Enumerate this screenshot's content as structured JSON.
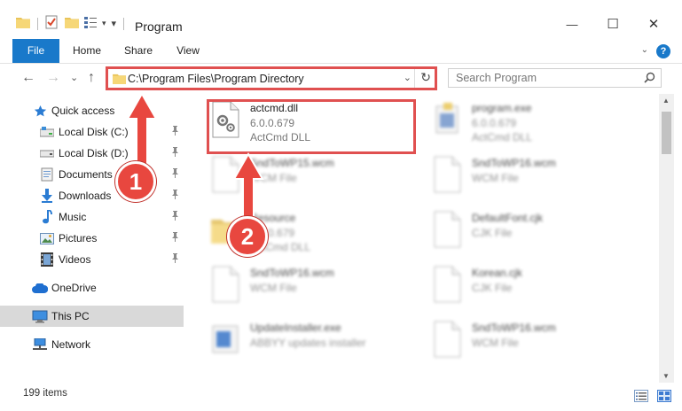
{
  "window": {
    "title": "Program",
    "minimize_glyph": "—",
    "maximize_glyph": "☐",
    "close_glyph": "✕"
  },
  "ribbon": {
    "tabs": [
      {
        "label": "File"
      },
      {
        "label": "Home"
      },
      {
        "label": "Share"
      },
      {
        "label": "View"
      }
    ],
    "help_glyph": "?",
    "collapse_glyph": "⌄"
  },
  "nav": {
    "back_glyph": "←",
    "forward_glyph": "→",
    "recent_glyph": "⌄",
    "up_glyph": "↑",
    "address": "C:\\Program Files\\Program Directory",
    "address_dropdown_glyph": "⌄",
    "refresh_glyph": "↻",
    "search_placeholder": "Search Program"
  },
  "sidebar": {
    "items": [
      {
        "label": "Quick access",
        "icon": "star-icon",
        "pinned": false
      },
      {
        "label": "Local Disk (C:)",
        "icon": "drive-icon",
        "pinned": true
      },
      {
        "label": "Local Disk (D:)",
        "icon": "drive-icon",
        "pinned": true
      },
      {
        "label": "Documents",
        "icon": "documents-icon",
        "pinned": true
      },
      {
        "label": "Downloads",
        "icon": "download-icon",
        "pinned": true
      },
      {
        "label": "Music",
        "icon": "music-icon",
        "pinned": true
      },
      {
        "label": "Pictures",
        "icon": "pictures-icon",
        "pinned": true
      },
      {
        "label": "Videos",
        "icon": "videos-icon",
        "pinned": true
      },
      {
        "label": "OneDrive",
        "icon": "cloud-icon",
        "pinned": false
      },
      {
        "label": "This PC",
        "icon": "computer-icon",
        "pinned": false,
        "selected": true
      },
      {
        "label": "Network",
        "icon": "network-icon",
        "pinned": false
      }
    ],
    "pin_glyph": "📌"
  },
  "files": [
    {
      "name": "actcmd.dll",
      "line2": "6.0.0.679",
      "line3": "ActCmd DLL",
      "icon": "dll-gear-icon",
      "highlighted": true
    },
    {
      "name": "program.exe",
      "line2": "6.0.0.679",
      "line3": "ActCmd DLL",
      "icon": "exe-icon"
    },
    {
      "name": "SndToWP15.wcm",
      "line2": "WCM File",
      "line3": "",
      "icon": "file-icon"
    },
    {
      "name": "SndToWP16.wcm",
      "line2": "WCM File",
      "line3": "",
      "icon": "file-icon"
    },
    {
      "name": "Resource",
      "line2": "6.0.0.679",
      "line3": "ActCmd DLL",
      "icon": "folder-icon"
    },
    {
      "name": "DefaultFont.cjk",
      "line2": "CJK File",
      "line3": "",
      "icon": "file-icon"
    },
    {
      "name": "SndToWP16.wcm",
      "line2": "WCM File",
      "line3": "",
      "icon": "file-icon"
    },
    {
      "name": "Korean.cjk",
      "line2": "CJK File",
      "line3": "",
      "icon": "file-icon"
    },
    {
      "name": "UpdateInstaller.exe",
      "line2": "ABBYY updates installer",
      "line3": "",
      "icon": "installer-icon"
    },
    {
      "name": "SndToWP16.wcm",
      "line2": "WCM File",
      "line3": "",
      "icon": "file-icon"
    }
  ],
  "status": {
    "item_count": "199 items"
  },
  "callouts": [
    {
      "number": "1"
    },
    {
      "number": "2"
    }
  ],
  "colors": {
    "accent": "#1979ca",
    "highlight": "#e05050",
    "badge": "#e8473f"
  }
}
